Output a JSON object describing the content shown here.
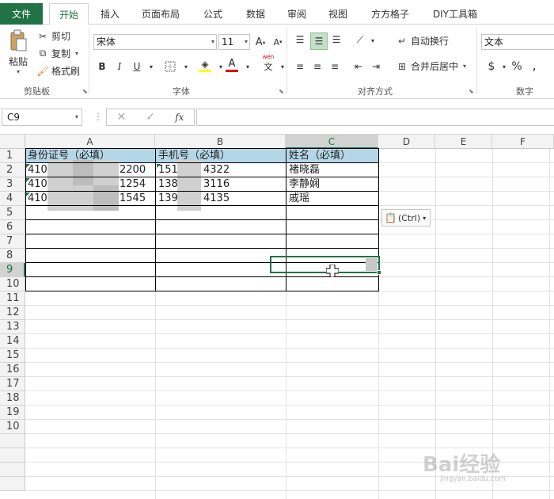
{
  "tabs": {
    "file": "文件",
    "items": [
      "开始",
      "插入",
      "页面布局",
      "公式",
      "数据",
      "审阅",
      "视图",
      "方方格子",
      "DIY工具箱"
    ]
  },
  "ribbon": {
    "clipboard": {
      "paste": "粘贴",
      "cut": "剪切",
      "copy": "复制",
      "format_painter": "格式刷",
      "label": "剪贴板"
    },
    "font": {
      "name": "宋体",
      "size": "11",
      "grow": "A",
      "shrink": "A",
      "bold": "B",
      "italic": "I",
      "underline": "U",
      "label": "字体",
      "wen": "wén",
      "phonetic": "文"
    },
    "alignment": {
      "wrap": "自动换行",
      "merge": "合并后居中",
      "label": "对齐方式"
    },
    "number": {
      "format": "文本",
      "currency": "$",
      "percent": "%",
      "comma": ",",
      "label": "数字"
    }
  },
  "formula_bar": {
    "namebox": "C9",
    "fx": "fx",
    "value": ""
  },
  "columns": [
    "A",
    "B",
    "C",
    "D",
    "E",
    "F"
  ],
  "rows": [
    "1",
    "2",
    "3",
    "4",
    "5",
    "6",
    "7",
    "8",
    "9",
    "10",
    "11",
    "12",
    "13",
    "14",
    "15",
    "16",
    "17",
    "18",
    "19",
    "10"
  ],
  "table": {
    "headers": [
      "身份证号（必填）",
      "手机号（必填）",
      "姓名（必填）"
    ],
    "rows": [
      {
        "id_prefix": "410",
        "id_suffix": "2200",
        "phone_prefix": "151",
        "phone_suffix": "4322",
        "name": "褚晓磊"
      },
      {
        "id_prefix": "410",
        "id_suffix": "1254",
        "phone_prefix": "138",
        "phone_suffix": "3116",
        "name": "李静娴"
      },
      {
        "id_prefix": "410",
        "id_suffix": "1545",
        "phone_prefix": "139",
        "phone_suffix": "4135",
        "name": "戚瑶"
      }
    ]
  },
  "paste_options": "(Ctrl)",
  "watermark": {
    "main": "Bai经验",
    "sub": "jingyan.baidu.com"
  },
  "colors": {
    "accent": "#217346",
    "header_fill": "#b4d7e8"
  }
}
